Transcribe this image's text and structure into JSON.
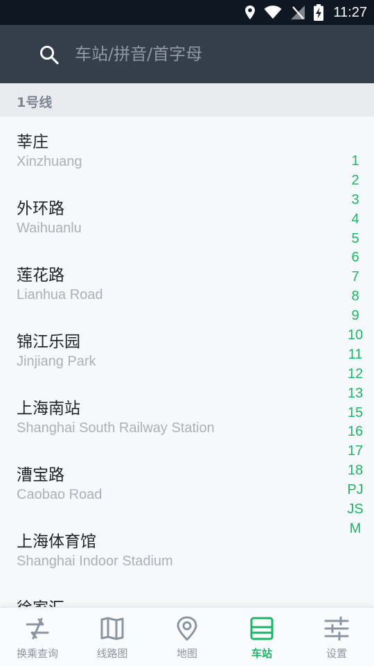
{
  "status_bar": {
    "time": "11:27"
  },
  "search": {
    "placeholder": "车站/拼音/首字母"
  },
  "section": {
    "title": "1号线"
  },
  "stations": [
    {
      "cn": "莘庄",
      "en": "Xinzhuang"
    },
    {
      "cn": "外环路",
      "en": "Waihuanlu"
    },
    {
      "cn": "莲花路",
      "en": "Lianhua Road"
    },
    {
      "cn": "锦江乐园",
      "en": "Jinjiang Park"
    },
    {
      "cn": "上海南站",
      "en": "Shanghai South Railway Station"
    },
    {
      "cn": "漕宝路",
      "en": "Caobao Road"
    },
    {
      "cn": "上海体育馆",
      "en": "Shanghai Indoor Stadium"
    },
    {
      "cn": "徐家汇",
      "en": ""
    }
  ],
  "index": [
    "1",
    "2",
    "3",
    "4",
    "5",
    "6",
    "7",
    "8",
    "9",
    "10",
    "11",
    "12",
    "13",
    "15",
    "16",
    "17",
    "18",
    "PJ",
    "JS",
    "M"
  ],
  "tabs": [
    {
      "label": "换乘查询",
      "icon": "transfer-icon"
    },
    {
      "label": "线路图",
      "icon": "map-book-icon"
    },
    {
      "label": "地图",
      "icon": "location-pin-icon"
    },
    {
      "label": "车站",
      "icon": "station-icon"
    },
    {
      "label": "设置",
      "icon": "settings-sliders-icon"
    }
  ],
  "colors": {
    "accent": "#1fb36a",
    "header": "#353f4c",
    "status_bar": "#0f1822",
    "tab_inactive": "#8b95a1"
  }
}
